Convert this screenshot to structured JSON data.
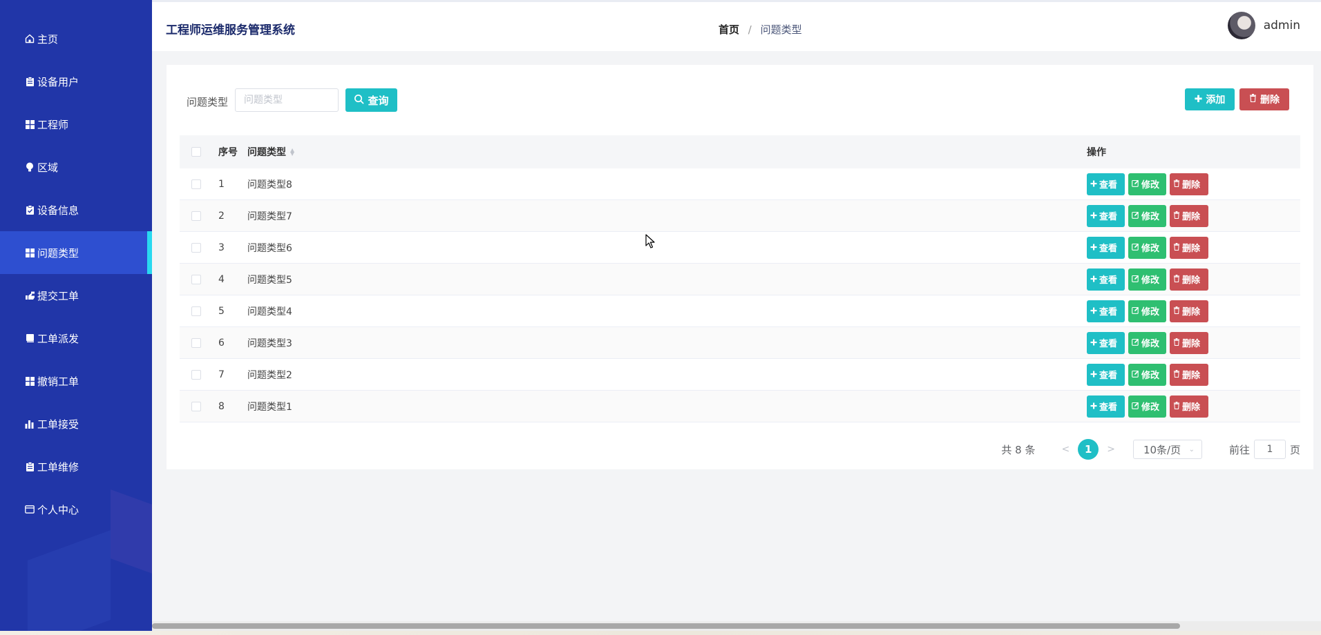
{
  "sidebar": {
    "items": [
      {
        "label": "主页",
        "icon": "home-icon"
      },
      {
        "label": "设备用户",
        "icon": "clipboard-icon"
      },
      {
        "label": "工程师",
        "icon": "grid-icon"
      },
      {
        "label": "区域",
        "icon": "bulb-icon"
      },
      {
        "label": "设备信息",
        "icon": "clipboard-check-icon"
      },
      {
        "label": "问题类型",
        "icon": "grid-icon",
        "active": true
      },
      {
        "label": "提交工单",
        "icon": "hand-icon"
      },
      {
        "label": "工单派发",
        "icon": "book-icon"
      },
      {
        "label": "撤销工单",
        "icon": "grid-icon"
      },
      {
        "label": "工单接受",
        "icon": "bar-chart-icon"
      },
      {
        "label": "工单维修",
        "icon": "clipboard-icon"
      },
      {
        "label": "个人中心",
        "icon": "card-icon"
      }
    ]
  },
  "header": {
    "app_title": "工程师运维服务管理系统",
    "breadcrumb": {
      "home": "首页",
      "separator": "/",
      "current": "问题类型"
    },
    "user": {
      "name": "admin"
    }
  },
  "search": {
    "label": "问题类型",
    "placeholder": "问题类型",
    "value": "",
    "query_label": "查询"
  },
  "toolbar": {
    "add_label": "添加",
    "delete_label": "删除"
  },
  "table": {
    "columns": {
      "index": "序号",
      "type": "问题类型",
      "ops": "操作"
    },
    "rows": [
      {
        "index": "1",
        "type": "问题类型8"
      },
      {
        "index": "2",
        "type": "问题类型7"
      },
      {
        "index": "3",
        "type": "问题类型6"
      },
      {
        "index": "4",
        "type": "问题类型5"
      },
      {
        "index": "5",
        "type": "问题类型4"
      },
      {
        "index": "6",
        "type": "问题类型3"
      },
      {
        "index": "7",
        "type": "问题类型2"
      },
      {
        "index": "8",
        "type": "问题类型1"
      }
    ],
    "row_actions": {
      "view": "查看",
      "edit": "修改",
      "delete": "删除"
    }
  },
  "pagination": {
    "total": "共 8 条",
    "prev": "<",
    "current_page": "1",
    "next": ">",
    "page_size": "10条/页",
    "goto_label": "前往",
    "goto_value": "1",
    "page_unit": "页"
  },
  "colors": {
    "sidebar_bg": "#2136a8",
    "sidebar_active": "#2e4fd0",
    "active_marker": "#29d9f0",
    "primary": "#1fbfc6",
    "success": "#2fbf71",
    "danger": "#c94f53"
  }
}
